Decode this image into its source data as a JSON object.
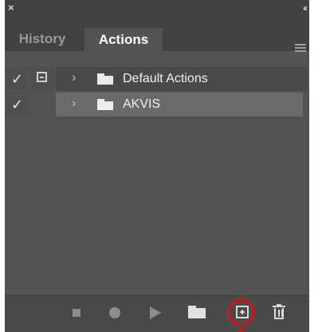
{
  "window": {
    "close_glyph": "×",
    "collapse_glyph": "‹‹"
  },
  "tabs": [
    {
      "label": "History",
      "active": false
    },
    {
      "label": "Actions",
      "active": true
    }
  ],
  "actions_list": [
    {
      "label": "Default Actions",
      "enabled": true,
      "dialog_toggle": true,
      "expanded": false,
      "selected": false
    },
    {
      "label": "AKVIS",
      "enabled": true,
      "dialog_toggle": false,
      "expanded": false,
      "selected": true
    }
  ],
  "glyphs": {
    "check": "✓",
    "chevron": "›"
  },
  "footer": {
    "icons": [
      "stop-icon",
      "record-icon",
      "play-icon",
      "new-set-icon",
      "new-action-icon",
      "trash-icon"
    ],
    "highlighted": "new-action-icon"
  },
  "colors": {
    "panel_bg": "#535353",
    "tab_strip_bg": "#424242",
    "selected_row": "#6a6a6a",
    "highlight_ring": "#d3121a"
  }
}
